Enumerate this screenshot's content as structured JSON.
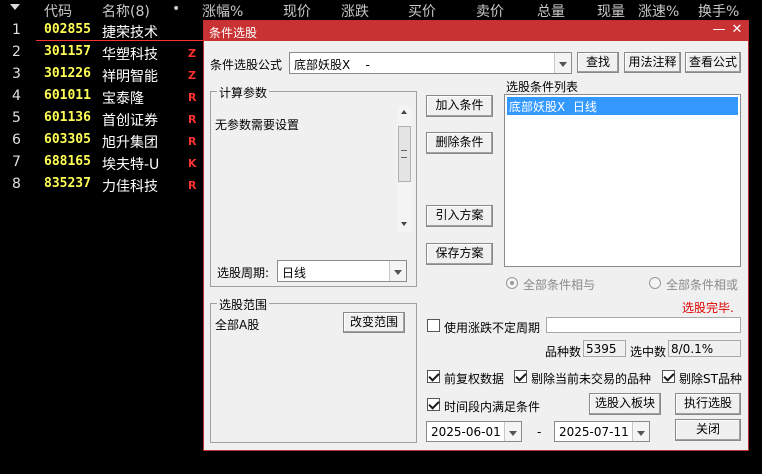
{
  "table": {
    "headers": [
      "代码",
      "名称(8)",
      "•",
      "涨幅%",
      "现价",
      "涨跌",
      "买价",
      "卖价",
      "总量",
      "现量",
      "涨速%",
      "换手%"
    ],
    "rows": [
      {
        "num": "1",
        "code": "002855",
        "name": "捷荣技术",
        "flag": ""
      },
      {
        "num": "2",
        "code": "301157",
        "name": "华塑科技",
        "flag": "Z"
      },
      {
        "num": "3",
        "code": "301226",
        "name": "祥明智能",
        "flag": "Z"
      },
      {
        "num": "4",
        "code": "601011",
        "name": "宝泰隆",
        "flag": "R"
      },
      {
        "num": "5",
        "code": "601136",
        "name": "首创证券",
        "flag": "R"
      },
      {
        "num": "6",
        "code": "603305",
        "name": "旭升集团",
        "flag": "R"
      },
      {
        "num": "7",
        "code": "688165",
        "name": "埃夫特-U",
        "flag": "K"
      },
      {
        "num": "8",
        "code": "835237",
        "name": "力佳科技",
        "flag": "R"
      }
    ]
  },
  "dialog": {
    "title": "条件选股",
    "formula_label": "条件选股公式",
    "formula_value": "底部妖股X    -",
    "find_button": "查找",
    "usage_button": "用法注释",
    "view_button": "查看公式",
    "params_group": "计算参数",
    "params_text": "无参数需要设置",
    "period_label": "选股周期:",
    "period_value": "日线",
    "scope_group": "选股范围",
    "scope_value": "全部A股",
    "change_scope_button": "改变范围",
    "add_condition_button": "加入条件",
    "remove_condition_button": "删除条件",
    "import_scheme_button": "引入方案",
    "save_scheme_button": "保存方案",
    "condition_list_label": "选股条件列表",
    "conditions": [
      "底部妖股X  日线"
    ],
    "radio_and": "全部条件相与",
    "radio_or": "全部条件相或",
    "status": "选股完毕.",
    "use_period_label": "使用涨跌不定周期",
    "count_label": "品种数",
    "count_value": "5395",
    "selected_label": "选中数",
    "selected_value": "8/0.1%",
    "forward_adjust_label": "前复权数据",
    "exclude_untraded_label": "剔除当前未交易的品种",
    "exclude_st_label": "剔除ST品种",
    "time_period_label": "时间段内满足条件",
    "to_board_button": "选股入板块",
    "execute_button": "执行选股",
    "date_from": "2025-06-01",
    "date_sep": "-",
    "date_to": "2025-07-11",
    "close_button": "关闭"
  },
  "colors": {
    "title_bar": "#c83232",
    "selection": "#3399ff",
    "status_text": "#e00000",
    "stock_code": "#ffff55"
  }
}
